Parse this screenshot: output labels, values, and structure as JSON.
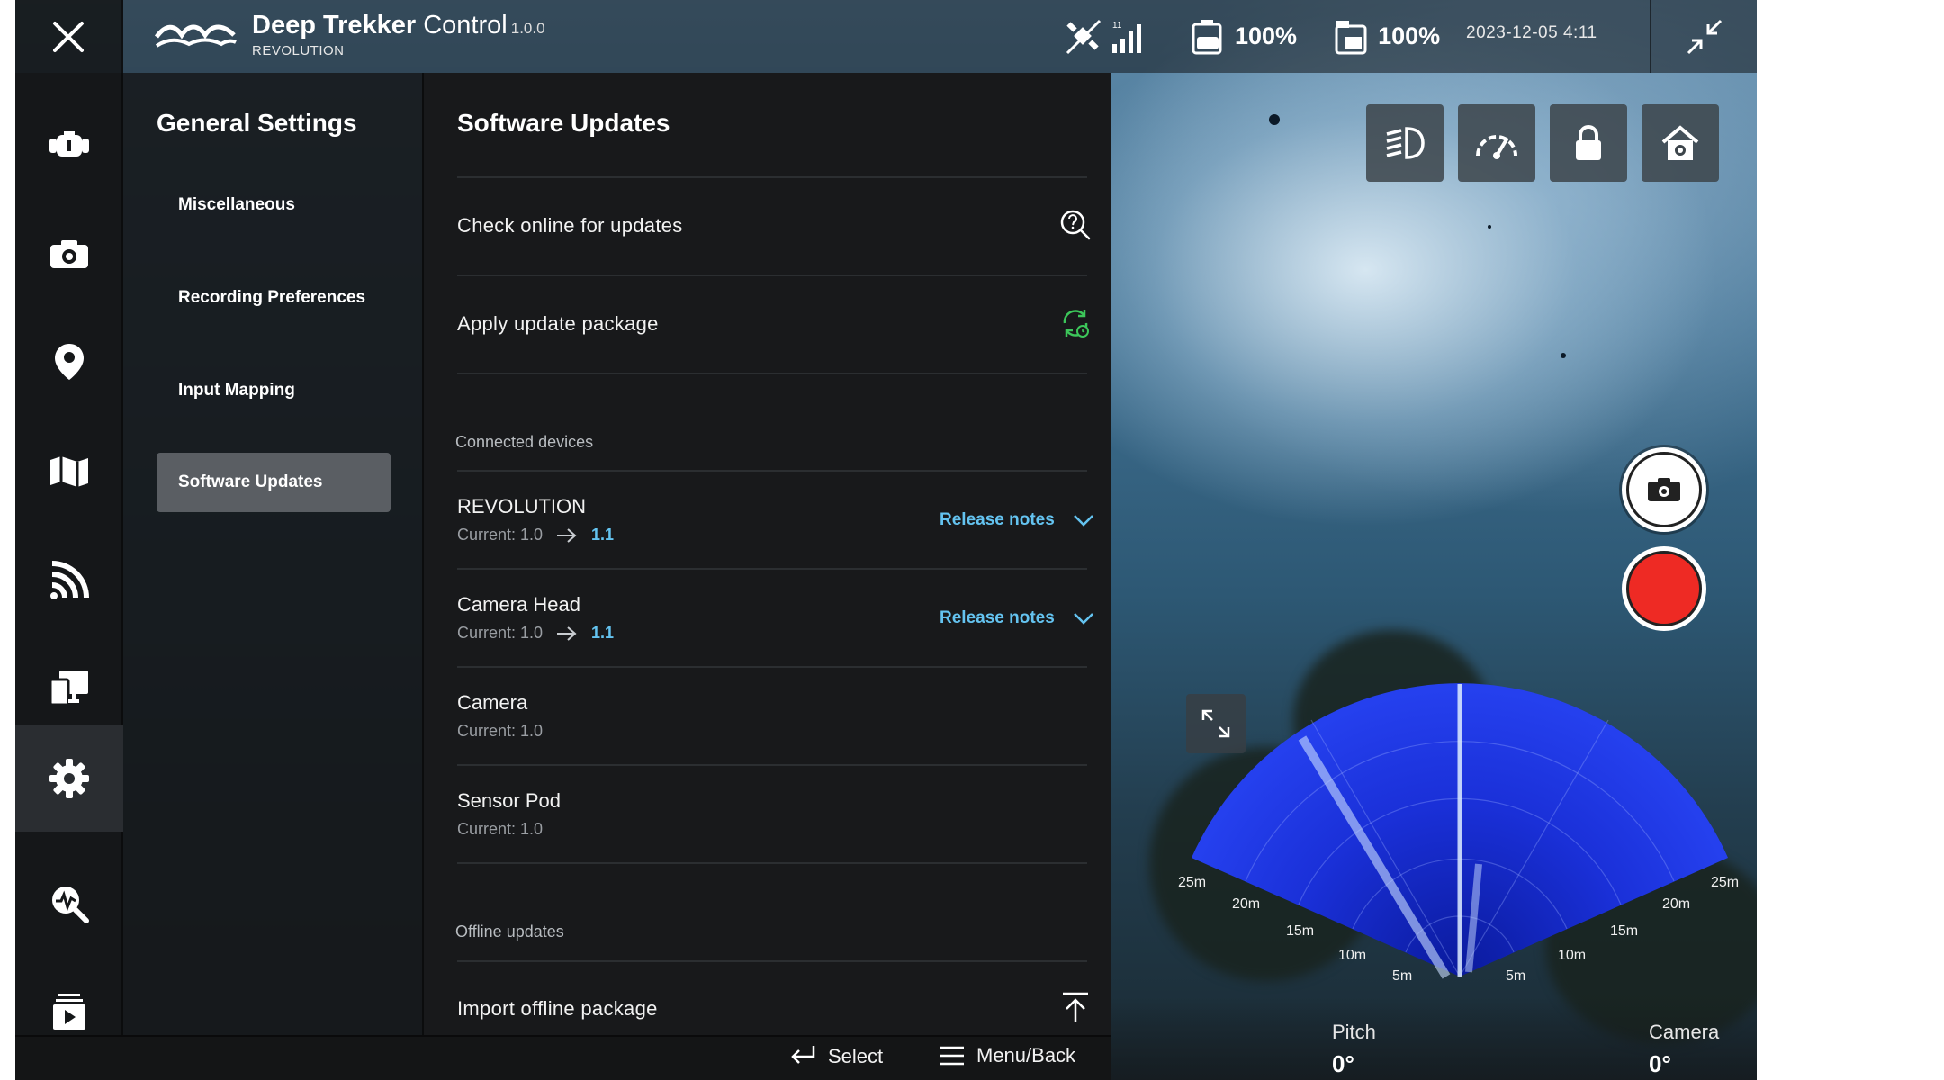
{
  "app": {
    "brand_name_bold": "Deep Trekker",
    "brand_name_regular": "Control",
    "version": "1.0.0",
    "device": "REVOLUTION",
    "datetime": "2023-12-05 4:11",
    "controller_battery": "100%",
    "vehicle_battery": "100%"
  },
  "leftnav": {
    "items": [
      {
        "icon": "vehicle-icon"
      },
      {
        "icon": "camera-icon"
      },
      {
        "icon": "location-pin-icon"
      },
      {
        "icon": "map-icon"
      },
      {
        "icon": "sonar-icon"
      },
      {
        "icon": "display-icon"
      },
      {
        "icon": "gear-icon",
        "active": true
      },
      {
        "icon": "diagnostics-icon"
      },
      {
        "icon": "media-library-icon"
      }
    ]
  },
  "settings": {
    "title": "General Settings",
    "items": [
      {
        "label": "Miscellaneous"
      },
      {
        "label": "Recording Preferences"
      },
      {
        "label": "Input Mapping"
      },
      {
        "label": "Software Updates",
        "active": true
      }
    ]
  },
  "updates": {
    "title": "Software Updates",
    "check_online": "Check online for updates",
    "apply_package": "Apply update package",
    "connected_devices_label": "Connected devices",
    "release_notes": "Release notes",
    "devices": [
      {
        "name": "REVOLUTION",
        "current": "Current: 1.0",
        "new": "1.1"
      },
      {
        "name": "Camera Head",
        "current": "Current: 1.0",
        "new": "1.1"
      },
      {
        "name": "Camera",
        "current": "Current: 1.0"
      },
      {
        "name": "Sensor Pod",
        "current": "Current: 1.0"
      }
    ],
    "offline_label": "Offline updates",
    "import_offline": "Import offline package"
  },
  "bottombar": {
    "select": "Select",
    "menu_back": "Menu/Back"
  },
  "telemetry": {
    "pitch_label": "Pitch",
    "pitch_value": "0°",
    "camera_label": "Camera",
    "camera_value": "0°"
  },
  "sonar": {
    "range_labels_left": [
      "25m",
      "20m",
      "15m",
      "10m",
      "5m"
    ],
    "range_labels_right": [
      "25m",
      "20m",
      "15m",
      "10m",
      "5m"
    ]
  },
  "colors": {
    "accent_blue": "#64c3f0",
    "apply_green": "#3cc65a",
    "record_red": "#ee2a24",
    "sonar_blue": "#1b2fd8"
  }
}
